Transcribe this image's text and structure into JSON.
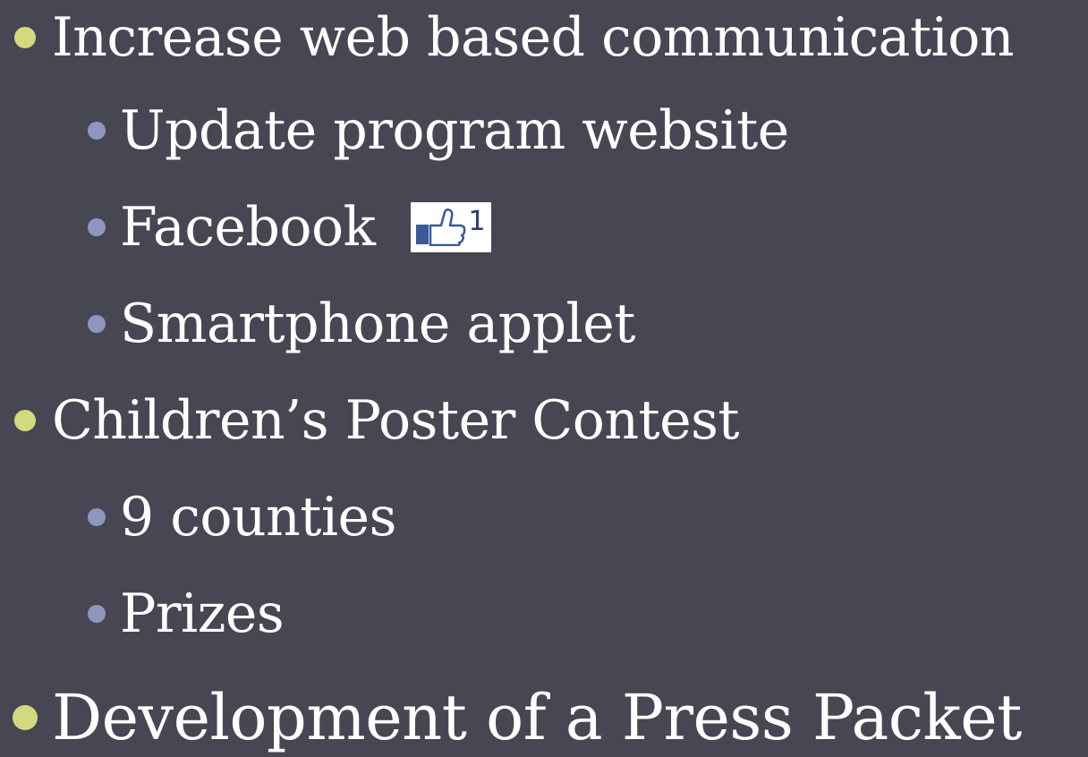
{
  "bullets": [
    {
      "level": 1,
      "text": "Increase web based communication"
    },
    {
      "level": 2,
      "text": "Update program website"
    },
    {
      "level": 2,
      "text": "Facebook"
    },
    {
      "level": 2,
      "text": "Smartphone applet"
    },
    {
      "level": 1,
      "text": "Children’s Poster Contest"
    },
    {
      "level": 2,
      "text": "9 counties"
    },
    {
      "level": 2,
      "text": "Prizes"
    },
    {
      "level": 1,
      "text": "Development of a Press Packet"
    }
  ],
  "facebook_like": {
    "icon": "thumbs-up-icon",
    "count": "1"
  },
  "colors": {
    "background": "#474753",
    "text": "#ffffff",
    "bullet_level1": "#d3d97e",
    "bullet_level2": "#8e95bf",
    "like_accent": "#3b5998"
  }
}
